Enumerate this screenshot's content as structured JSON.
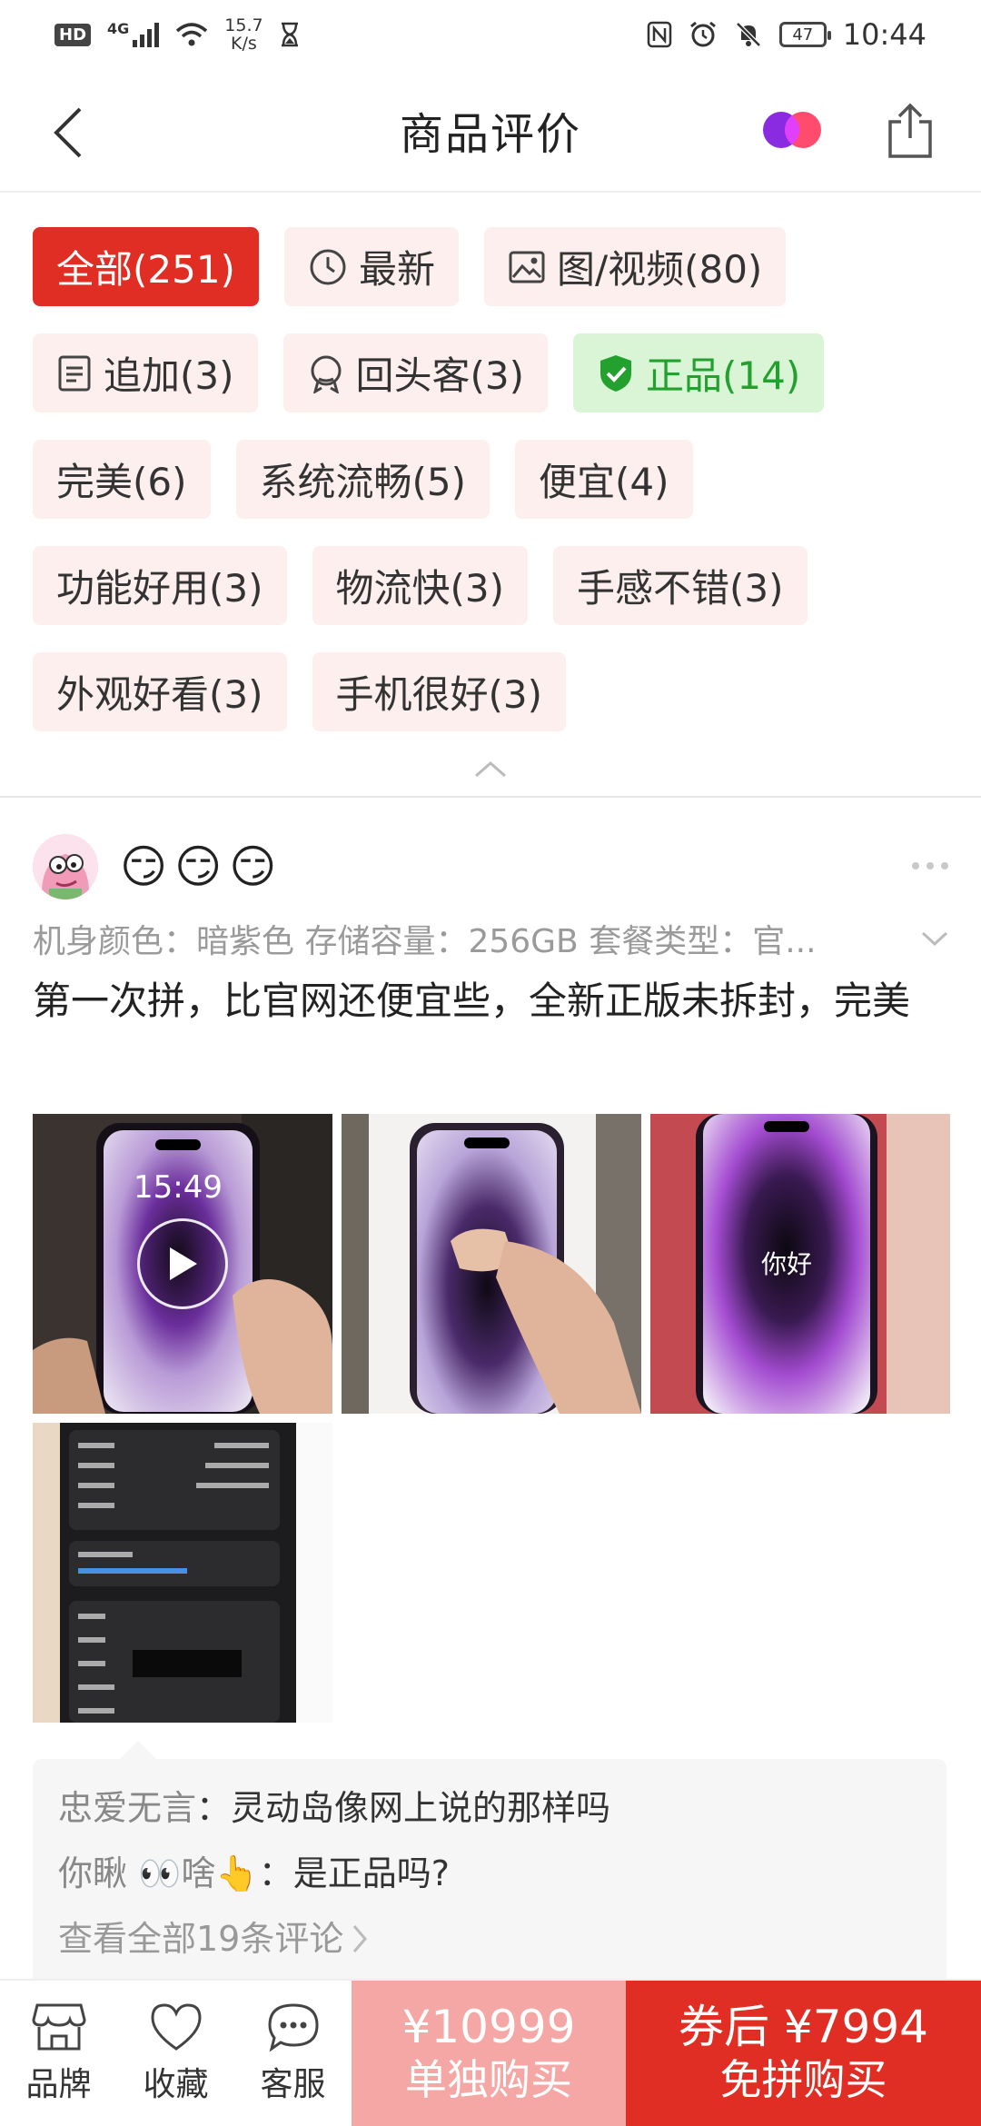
{
  "status_bar": {
    "hd": "HD",
    "network": "4G",
    "speed_value": "15.7",
    "speed_unit": "K/s",
    "battery": "47",
    "time": "10:44"
  },
  "header": {
    "title": "商品评价"
  },
  "filters": [
    {
      "label": "全部(251)",
      "style": "active",
      "icon": ""
    },
    {
      "label": "最新",
      "style": "normal",
      "icon": "clock-icon"
    },
    {
      "label": "图/视频(80)",
      "style": "normal",
      "icon": "image-icon"
    },
    {
      "label": "追加(3)",
      "style": "normal",
      "icon": "document-icon"
    },
    {
      "label": "回头客(3)",
      "style": "normal",
      "icon": "rosette-icon"
    },
    {
      "label": "正品(14)",
      "style": "green",
      "icon": "shield-check-icon"
    },
    {
      "label": "完美(6)",
      "style": "normal",
      "icon": ""
    },
    {
      "label": "系统流畅(5)",
      "style": "normal",
      "icon": ""
    },
    {
      "label": "便宜(4)",
      "style": "normal",
      "icon": ""
    },
    {
      "label": "功能好用(3)",
      "style": "normal",
      "icon": ""
    },
    {
      "label": "物流快(3)",
      "style": "normal",
      "icon": ""
    },
    {
      "label": "手感不错(3)",
      "style": "normal",
      "icon": ""
    },
    {
      "label": "外观好看(3)",
      "style": "normal",
      "icon": ""
    },
    {
      "label": "手机很好(3)",
      "style": "normal",
      "icon": ""
    }
  ],
  "review": {
    "username": "😏😏😏",
    "specs": "机身颜色：暗紫色  存储容量：256GB  套餐类型：官...",
    "text": "第一次拼，比官网还便宜些，全新正版未拆封，完美",
    "photo1_time": "15:49",
    "photo3_text": "你好",
    "comments": [
      {
        "user": "忠爱无言",
        "text": "灵动岛像网上说的那样吗"
      },
      {
        "user": "你瞅 👀啥👆",
        "text": "是正品吗?"
      }
    ],
    "view_all": "查看全部19条评论"
  },
  "bottom_bar": {
    "nav": [
      {
        "label": "品牌",
        "icon": "store-icon"
      },
      {
        "label": "收藏",
        "icon": "heart-icon"
      },
      {
        "label": "客服",
        "icon": "chat-icon"
      }
    ],
    "solo_price": "¥10999",
    "solo_label": "单独购买",
    "group_price": "券后 ¥7994",
    "group_label": "免拼购买"
  },
  "colors": {
    "accent_red": "#e02e24",
    "tag_bg": "#fcefee",
    "green": "#23a02e",
    "green_bg": "#d9f5d6",
    "solo_bg": "#f4a7a4"
  }
}
